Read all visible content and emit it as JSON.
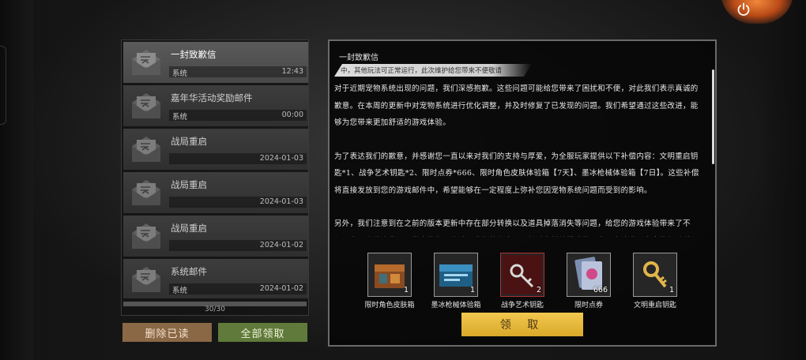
{
  "mail_list": {
    "items": [
      {
        "title": "一封致歉信",
        "sender": "系统",
        "time": "12:43",
        "selected": true
      },
      {
        "title": "嘉年华活动奖励邮件",
        "sender": "系统",
        "time": "00:00"
      },
      {
        "title": "战局重启",
        "sender": "",
        "time": "2024-01-03"
      },
      {
        "title": "战局重启",
        "sender": "",
        "time": "2024-01-03"
      },
      {
        "title": "战局重启",
        "sender": "",
        "time": "2024-01-02"
      },
      {
        "title": "系统邮件",
        "sender": "系统",
        "time": "2024-01-02"
      }
    ],
    "count": "30/30"
  },
  "buttons": {
    "delete_read": "删除已读",
    "collect_all": "全部领取",
    "claim": "领 取"
  },
  "content": {
    "title": "一封致歉信",
    "notice": "中，其他玩法可正常运行，此次维护给您带来不便敬请",
    "paragraphs": [
      "对于近期宠物系统出现的问题，我们深感抱歉。这些问题可能给您带来了困扰和不便，对此我们表示真诚的歉意。在本周的更新中对宠物系统进行优化调整，并及时修复了已发现的问题。我们希望通过这些改进，能够为您带来更加舒适的游戏体验。",
      "为了表达我们的歉意，并感谢您一直以来对我们的支持与厚爱，为全服玩家提供以下补偿内容：文明重启钥匙*1、战争艺术钥匙*2、限时点券*666、限时角色皮肤体验箱【7天】、墨冰枪械体验箱【7日】。这些补偿将直接发放到您的游戏邮件中，希望能够在一定程度上弥补您因宠物系统问题而受到的影响。",
      "另外，我们注意到在之前的版本更新中存在部分转换以及道具掉落消失等问题，给您的游戏体验带来了不便。为了弥补这些问题带来的负面体验，我们将在本周更新后为基地模式的玩家再次补发一次宠物相关道具。"
    ]
  },
  "rewards": [
    {
      "name": "限时角色皮肤箱",
      "qty": "1",
      "icon": "skin-crate-icon"
    },
    {
      "name": "墨冰枪械体验箱",
      "qty": "1",
      "icon": "weapon-crate-icon"
    },
    {
      "name": "战争艺术钥匙",
      "qty": "2",
      "icon": "war-art-key-icon"
    },
    {
      "name": "限时点券",
      "qty": "666",
      "icon": "coupon-icon"
    },
    {
      "name": "文明重启钥匙",
      "qty": "1",
      "icon": "civilization-key-icon"
    }
  ],
  "colors": {
    "accent_gold": "#d9a92a",
    "delete_button": "#8a6846",
    "collect_button": "#5f7a3a",
    "power_glow": "#f0893b"
  }
}
